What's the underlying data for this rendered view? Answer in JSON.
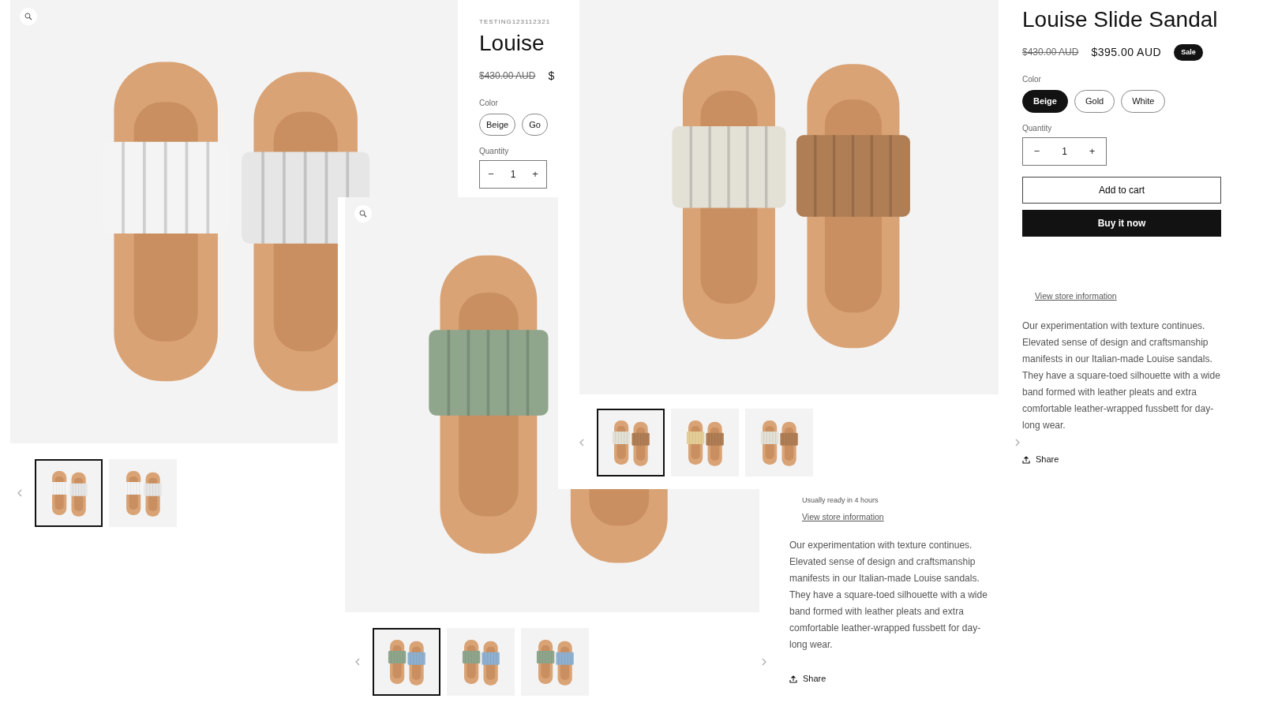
{
  "views": [
    {
      "zoom_control": true,
      "thumbnails": [
        {
          "selected": true
        },
        {
          "selected": false
        }
      ],
      "vendor": "TESTING123112321",
      "title": "Louise",
      "compare_price": "$430.00 AUD",
      "price": "$",
      "color_label": "Color",
      "swatches": [
        {
          "label": "Beige",
          "selected": false
        },
        {
          "label": "Go",
          "selected": false
        }
      ],
      "quantity_label": "Quantity",
      "quantity": "1",
      "minus": "−",
      "plus": "+"
    },
    {
      "zoom_control": true,
      "thumbnails": [
        {
          "selected": true
        },
        {
          "selected": false
        },
        {
          "selected": false
        }
      ],
      "pickup_note": "Usually ready in 4 hours",
      "store_link": "View store information",
      "description": "Our experimentation with texture continues. Elevated sense of design and craftsmanship manifests in our Italian-made Louise sandals. They have a square-toed silhouette with a wide band formed with leather pleats and extra comfortable leather-wrapped fussbett for day-long wear.",
      "share": "Share"
    },
    {
      "thumbnails": [
        {
          "selected": true
        },
        {
          "selected": false
        },
        {
          "selected": false
        }
      ],
      "title": "Louise Slide Sandal",
      "compare_price": "$430.00 AUD",
      "price": "$395.00 AUD",
      "sale_badge": "Sale",
      "color_label": "Color",
      "swatches": [
        {
          "label": "Beige",
          "selected": true
        },
        {
          "label": "Gold",
          "selected": false
        },
        {
          "label": "White",
          "selected": false
        }
      ],
      "quantity_label": "Quantity",
      "quantity": "1",
      "minus": "−",
      "plus": "+",
      "add_to_cart": "Add to cart",
      "buy_now": "Buy it now",
      "store_link": "View store information",
      "description": "Our experimentation with texture continues. Elevated sense of design and craftsmanship manifests in our Italian-made Louise sandals. They have a square-toed silhouette with a wide band formed with leather pleats and extra comfortable leather-wrapped fussbett for day-long wear.",
      "share": "Share"
    }
  ]
}
